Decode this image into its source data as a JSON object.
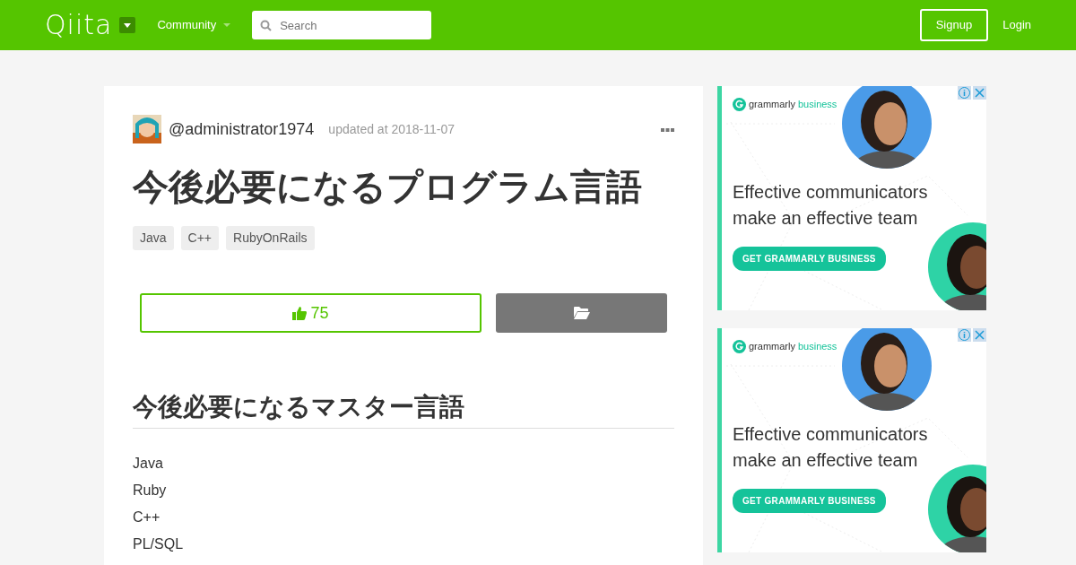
{
  "header": {
    "logo": "Qiita",
    "menu": "Community",
    "search": {
      "placeholder": "Search"
    },
    "signup": "Signup",
    "login": "Login"
  },
  "article": {
    "author": "@administrator1974",
    "updated": "updated at 2018-11-07",
    "title": "今後必要になるプログラム言語",
    "tags": [
      "Java",
      "C++",
      "RubyOnRails"
    ],
    "like_count": "75",
    "section_heading": "今後必要になるマスター言語",
    "items": [
      "Java",
      "Ruby",
      "C++",
      "PL/SQL"
    ]
  },
  "ads": [
    {
      "brand": "grammarly",
      "brand_suffix": "business",
      "headline": "Effective communicators make an effective team",
      "cta": "GET GRAMMARLY BUSINESS"
    },
    {
      "brand": "grammarly",
      "brand_suffix": "business",
      "headline": "Effective communicators make an effective team",
      "cta": "GET GRAMMARLY BUSINESS"
    }
  ]
}
